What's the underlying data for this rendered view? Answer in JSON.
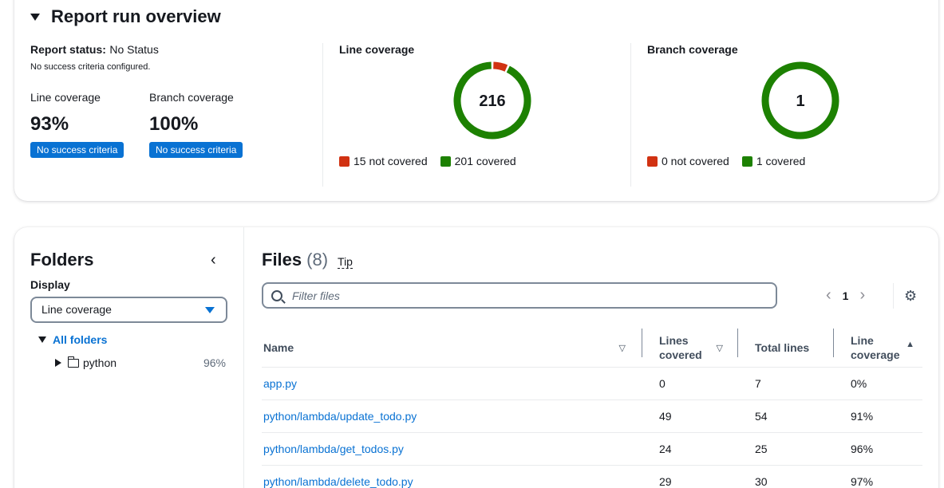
{
  "overview": {
    "title": "Report run overview",
    "report_status_label": "Report status:",
    "report_status_value": "No Status",
    "criteria_note": "No success criteria configured.",
    "line_coverage": {
      "label": "Line coverage",
      "value": "93%",
      "badge": "No success criteria"
    },
    "branch_coverage": {
      "label": "Branch coverage",
      "value": "100%",
      "badge": "No success criteria"
    },
    "line_chart": {
      "title": "Line coverage",
      "total": "216",
      "not_covered": 15,
      "covered": 201,
      "legend_not_covered": "15 not covered",
      "legend_covered": "201 covered"
    },
    "branch_chart": {
      "title": "Branch coverage",
      "total": "1",
      "not_covered": 0,
      "covered": 1,
      "legend_not_covered": "0 not covered",
      "legend_covered": "1 covered"
    },
    "colors": {
      "covered": "#1d8102",
      "not_covered": "#d13212"
    }
  },
  "folders": {
    "title": "Folders",
    "display_label": "Display",
    "display_selected": "Line coverage",
    "tree": {
      "root": "All folders",
      "children": [
        {
          "name": "python",
          "pct": "96%"
        }
      ]
    }
  },
  "files": {
    "title": "Files",
    "count": "(8)",
    "tip": "Tip",
    "filter_placeholder": "Filter files",
    "page": "1",
    "columns": {
      "name": "Name",
      "lines_covered": "Lines covered",
      "total_lines": "Total lines",
      "line_coverage": "Line coverage"
    },
    "rows": [
      {
        "name": "app.py",
        "lines_covered": "0",
        "total_lines": "7",
        "coverage": "0%"
      },
      {
        "name": "python/lambda/update_todo.py",
        "lines_covered": "49",
        "total_lines": "54",
        "coverage": "91%"
      },
      {
        "name": "python/lambda/get_todos.py",
        "lines_covered": "24",
        "total_lines": "25",
        "coverage": "96%"
      },
      {
        "name": "python/lambda/delete_todo.py",
        "lines_covered": "29",
        "total_lines": "30",
        "coverage": "97%"
      }
    ]
  }
}
